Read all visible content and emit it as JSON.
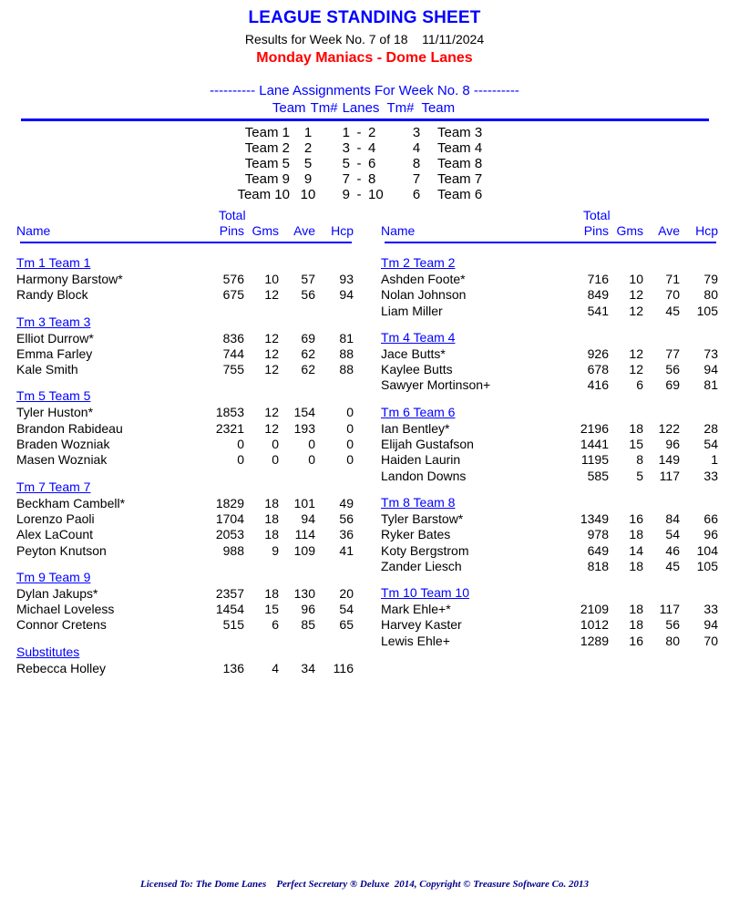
{
  "header": {
    "title": "LEAGUE STANDING SHEET",
    "results_line": "Results for Week No. 7 of 18    11/11/2024",
    "league_line": "Monday Maniacs - Dome Lanes"
  },
  "lane_assignments": {
    "heading": "---------- Lane Assignments For Week No. 8 ----------",
    "columns": {
      "team_left": "Team",
      "tm_num_left": "Tm#",
      "lanes": "Lanes",
      "tm_num_right": "Tm#",
      "team_right": "Team"
    },
    "rows": [
      {
        "team_left": "Team 1",
        "num_left": "1",
        "lane_a": "1",
        "dash": "-",
        "lane_b": "2",
        "num_right": "3",
        "team_right": "Team 3"
      },
      {
        "team_left": "Team 2",
        "num_left": "2",
        "lane_a": "3",
        "dash": "-",
        "lane_b": "4",
        "num_right": "4",
        "team_right": "Team 4"
      },
      {
        "team_left": "Team 5",
        "num_left": "5",
        "lane_a": "5",
        "dash": "-",
        "lane_b": "6",
        "num_right": "8",
        "team_right": "Team 8"
      },
      {
        "team_left": "Team 9",
        "num_left": "9",
        "lane_a": "7",
        "dash": "-",
        "lane_b": "8",
        "num_right": "7",
        "team_right": "Team 7"
      },
      {
        "team_left": "Team 10",
        "num_left": "10",
        "lane_a": "9",
        "dash": "-",
        "lane_b": "10",
        "num_right": "6",
        "team_right": "Team 6"
      }
    ]
  },
  "table_headers": {
    "total": "Total",
    "name": "Name",
    "pins": "Pins",
    "gms": "Gms",
    "ave": "Ave",
    "hcp": "Hcp"
  },
  "left_column": {
    "teams": [
      {
        "team_label": "Tm 1 Team 1",
        "players": [
          {
            "name": "Harmony Barstow*",
            "pins": "576",
            "gms": "10",
            "ave": "57",
            "hcp": "93"
          },
          {
            "name": "Randy Block",
            "pins": "675",
            "gms": "12",
            "ave": "56",
            "hcp": "94"
          }
        ]
      },
      {
        "team_label": "Tm 3 Team 3",
        "players": [
          {
            "name": "Elliot Durrow*",
            "pins": "836",
            "gms": "12",
            "ave": "69",
            "hcp": "81"
          },
          {
            "name": "Emma Farley",
            "pins": "744",
            "gms": "12",
            "ave": "62",
            "hcp": "88"
          },
          {
            "name": "Kale Smith",
            "pins": "755",
            "gms": "12",
            "ave": "62",
            "hcp": "88"
          }
        ]
      },
      {
        "team_label": "Tm 5 Team 5",
        "players": [
          {
            "name": "Tyler Huston*",
            "pins": "1853",
            "gms": "12",
            "ave": "154",
            "hcp": "0"
          },
          {
            "name": "Brandon Rabideau",
            "pins": "2321",
            "gms": "12",
            "ave": "193",
            "hcp": "0"
          },
          {
            "name": "Braden Wozniak",
            "pins": "0",
            "gms": "0",
            "ave": "0",
            "hcp": "0"
          },
          {
            "name": "Masen Wozniak",
            "pins": "0",
            "gms": "0",
            "ave": "0",
            "hcp": "0"
          }
        ]
      },
      {
        "team_label": "Tm 7 Team 7",
        "players": [
          {
            "name": "Beckham Cambell*",
            "pins": "1829",
            "gms": "18",
            "ave": "101",
            "hcp": "49"
          },
          {
            "name": "Lorenzo Paoli",
            "pins": "1704",
            "gms": "18",
            "ave": "94",
            "hcp": "56"
          },
          {
            "name": "Alex LaCount",
            "pins": "2053",
            "gms": "18",
            "ave": "114",
            "hcp": "36"
          },
          {
            "name": "Peyton Knutson",
            "pins": "988",
            "gms": "9",
            "ave": "109",
            "hcp": "41"
          }
        ]
      },
      {
        "team_label": "Tm 9 Team 9",
        "players": [
          {
            "name": "Dylan Jakups*",
            "pins": "2357",
            "gms": "18",
            "ave": "130",
            "hcp": "20"
          },
          {
            "name": "Michael Loveless",
            "pins": "1454",
            "gms": "15",
            "ave": "96",
            "hcp": "54"
          },
          {
            "name": "Connor Cretens",
            "pins": "515",
            "gms": "6",
            "ave": "85",
            "hcp": "65"
          }
        ]
      }
    ],
    "substitutes": {
      "label": "Substitutes",
      "players": [
        {
          "name": "Rebecca Holley",
          "pins": "136",
          "gms": "4",
          "ave": "34",
          "hcp": "116"
        }
      ]
    }
  },
  "right_column": {
    "teams": [
      {
        "team_label": "Tm 2 Team 2",
        "players": [
          {
            "name": "Ashden Foote*",
            "pins": "716",
            "gms": "10",
            "ave": "71",
            "hcp": "79"
          },
          {
            "name": "Nolan Johnson",
            "pins": "849",
            "gms": "12",
            "ave": "70",
            "hcp": "80"
          },
          {
            "name": "Liam Miller",
            "pins": "541",
            "gms": "12",
            "ave": "45",
            "hcp": "105"
          }
        ]
      },
      {
        "team_label": "Tm 4 Team 4",
        "players": [
          {
            "name": "Jace Butts*",
            "pins": "926",
            "gms": "12",
            "ave": "77",
            "hcp": "73"
          },
          {
            "name": "Kaylee Butts",
            "pins": "678",
            "gms": "12",
            "ave": "56",
            "hcp": "94"
          },
          {
            "name": "Sawyer Mortinson+",
            "pins": "416",
            "gms": "6",
            "ave": "69",
            "hcp": "81"
          }
        ]
      },
      {
        "team_label": "Tm 6 Team 6",
        "players": [
          {
            "name": "Ian Bentley*",
            "pins": "2196",
            "gms": "18",
            "ave": "122",
            "hcp": "28"
          },
          {
            "name": "Elijah Gustafson",
            "pins": "1441",
            "gms": "15",
            "ave": "96",
            "hcp": "54"
          },
          {
            "name": "Haiden Laurin",
            "pins": "1195",
            "gms": "8",
            "ave": "149",
            "hcp": "1"
          },
          {
            "name": "Landon Downs",
            "pins": "585",
            "gms": "5",
            "ave": "117",
            "hcp": "33"
          }
        ]
      },
      {
        "team_label": "Tm 8 Team 8",
        "players": [
          {
            "name": "Tyler Barstow*",
            "pins": "1349",
            "gms": "16",
            "ave": "84",
            "hcp": "66"
          },
          {
            "name": "Ryker Bates",
            "pins": "978",
            "gms": "18",
            "ave": "54",
            "hcp": "96"
          },
          {
            "name": "Koty Bergstrom",
            "pins": "649",
            "gms": "14",
            "ave": "46",
            "hcp": "104"
          },
          {
            "name": "Zander Liesch",
            "pins": "818",
            "gms": "18",
            "ave": "45",
            "hcp": "105"
          }
        ]
      },
      {
        "team_label": "Tm 10 Team 10",
        "players": [
          {
            "name": "Mark Ehle+*",
            "pins": "2109",
            "gms": "18",
            "ave": "117",
            "hcp": "33"
          },
          {
            "name": "Harvey Kaster",
            "pins": "1012",
            "gms": "18",
            "ave": "56",
            "hcp": "94"
          },
          {
            "name": "Lewis Ehle+",
            "pins": "1289",
            "gms": "16",
            "ave": "80",
            "hcp": "70"
          }
        ]
      }
    ]
  },
  "footer": {
    "text": "Licensed To: The Dome Lanes    Perfect Secretary ® Deluxe  2014, Copyright © Treasure Software Co. 2013"
  },
  "colors": {
    "heading_blue": "#0000ff",
    "league_red": "#ff0000",
    "footer_navy": "#00008b"
  }
}
